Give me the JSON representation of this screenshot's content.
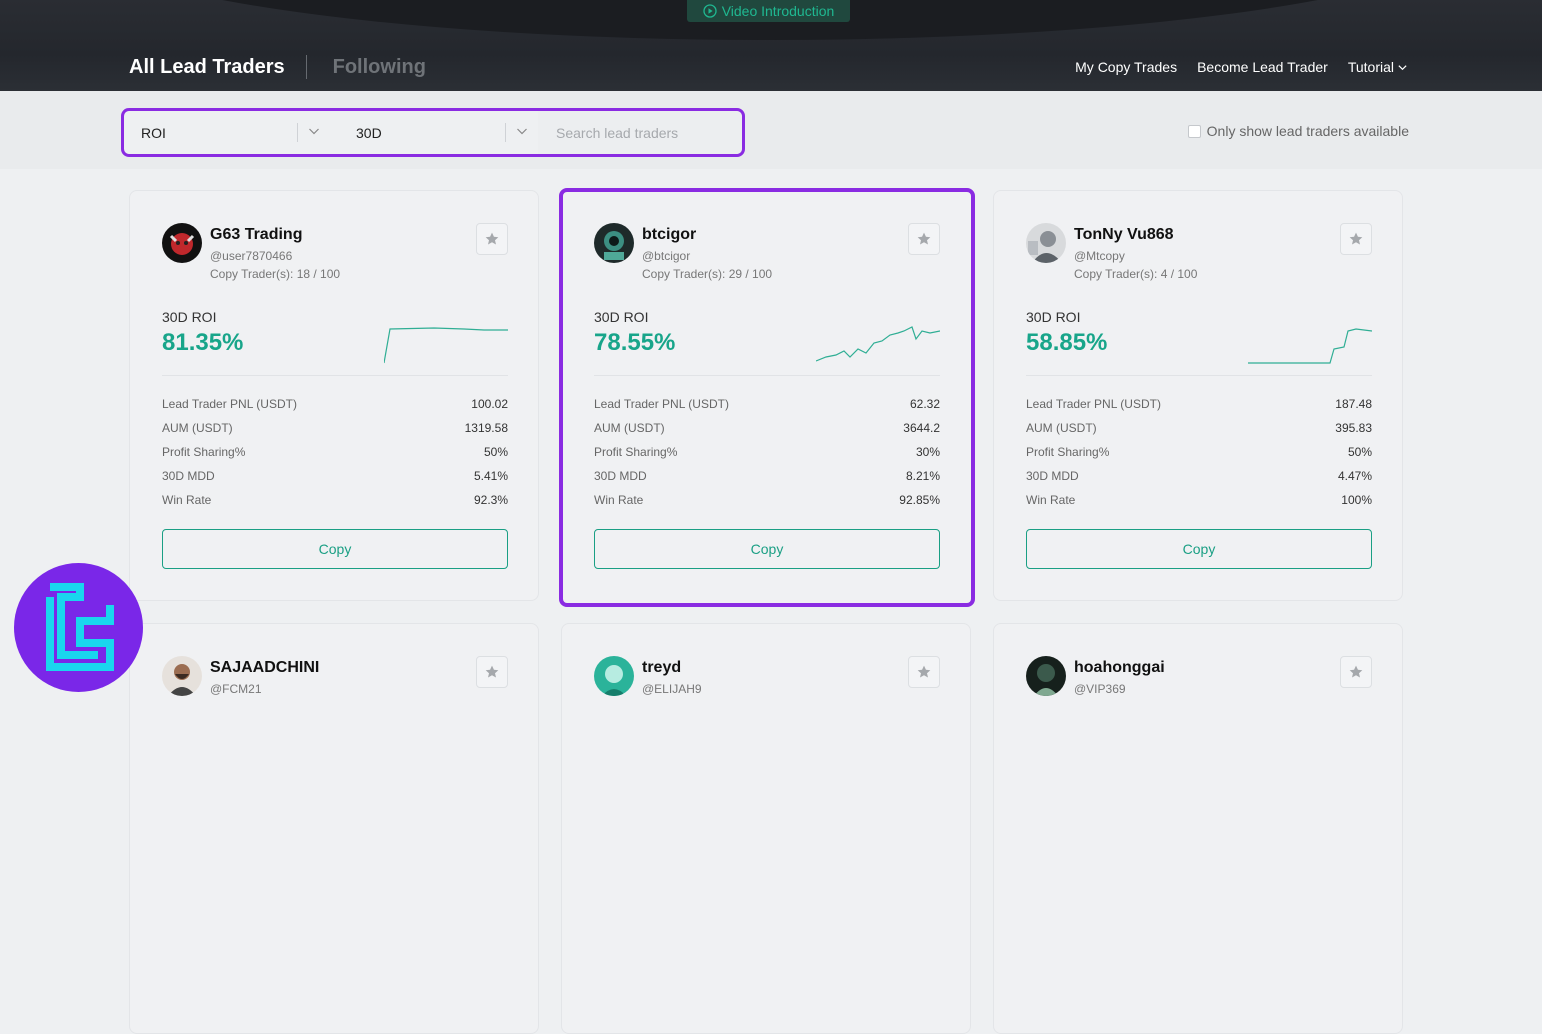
{
  "header": {
    "video_label": "Video Introduction",
    "tab_all": "All Lead Traders",
    "tab_following": "Following",
    "nav": [
      "My Copy Trades",
      "Become Lead Trader",
      "Tutorial"
    ]
  },
  "filters": {
    "sort_value": "ROI",
    "period_value": "30D",
    "search_placeholder": "Search lead traders",
    "only_available_label": "Only show lead traders available"
  },
  "stat_labels": {
    "pnl": "Lead Trader PNL (USDT)",
    "aum": "AUM (USDT)",
    "profit_sharing": "Profit Sharing%",
    "mdd": "30D MDD",
    "win_rate": "Win Rate"
  },
  "copy_label": "Copy",
  "roi_label": "30D ROI",
  "traders": [
    {
      "name": "G63 Trading",
      "handle": "@user7870466",
      "copy_traders": "Copy Trader(s): 18 / 100",
      "roi": "81.35%",
      "pnl": "100.02",
      "aum": "1319.58",
      "profit_sharing": "50%",
      "mdd": "5.41%",
      "win_rate": "92.3%"
    },
    {
      "name": "btcigor",
      "handle": "@btcigor",
      "copy_traders": "Copy Trader(s): 29 / 100",
      "roi": "78.55%",
      "pnl": "62.32",
      "aum": "3644.2",
      "profit_sharing": "30%",
      "mdd": "8.21%",
      "win_rate": "92.85%"
    },
    {
      "name": "TonNy Vu868",
      "handle": "@Mtcopy",
      "copy_traders": "Copy Trader(s): 4 / 100",
      "roi": "58.85%",
      "pnl": "187.48",
      "aum": "395.83",
      "profit_sharing": "50%",
      "mdd": "4.47%",
      "win_rate": "100%"
    },
    {
      "name": "SAJAADCHINI",
      "handle": "@FCM21"
    },
    {
      "name": "treyd",
      "handle": "@ELIJAH9"
    },
    {
      "name": "hoahonggai",
      "handle": "@VIP369"
    }
  ],
  "colors": {
    "accent": "#18a58a",
    "highlight": "#8a2be2",
    "header_bg": "#24272d"
  }
}
